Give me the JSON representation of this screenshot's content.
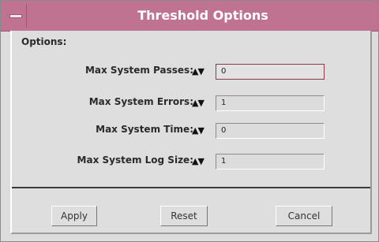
{
  "window": {
    "title": "Threshold Options",
    "menu_icon": "window-menu-icon"
  },
  "options": {
    "section_label": "Options:",
    "rows": [
      {
        "label": "Max System Passes:",
        "spinner": "▲▼",
        "value": "0"
      },
      {
        "label": "Max System Errors:",
        "spinner": "▲▼",
        "value": "1"
      },
      {
        "label": "Max System Time:",
        "spinner": "▲▼",
        "value": "0"
      },
      {
        "label": "Max System Log Size:",
        "spinner": "▲▼",
        "value": "1"
      }
    ]
  },
  "buttons": {
    "apply": "Apply",
    "reset": "Reset",
    "cancel": "Cancel"
  },
  "colors": {
    "titlebar": "#c07391",
    "background": "#dcdcdc",
    "active_field_border": "#8a3a4a"
  }
}
